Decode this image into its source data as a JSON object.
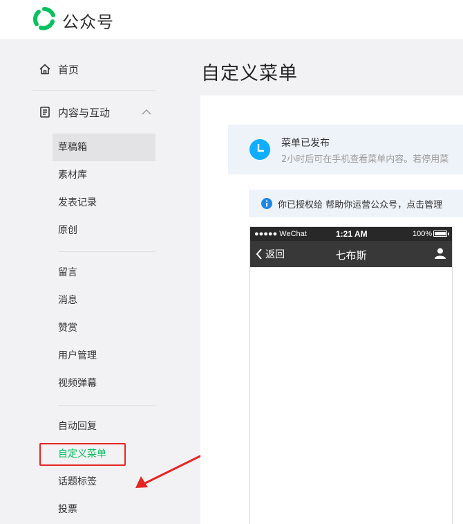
{
  "header": {
    "brand": "公众号"
  },
  "sidebar": {
    "home_label": "首页",
    "group_label": "内容与互动",
    "group1": [
      "草稿箱",
      "素材库",
      "发表记录",
      "原创"
    ],
    "group2": [
      "留言",
      "消息",
      "赞赏",
      "用户管理",
      "视频弹幕"
    ],
    "group3": [
      "自动回复",
      "自定义菜单",
      "话题标签",
      "投票"
    ]
  },
  "main": {
    "title": "自定义菜单",
    "notice": {
      "title": "菜单已发布",
      "desc": "2小时后可在手机查看菜单内容。若停用菜"
    },
    "info": "你已授权给  帮助你运营公众号，点击管理"
  },
  "phone": {
    "carrier": "●●●●● WeChat",
    "time": "1:21 AM",
    "battery": "100%",
    "back_label": "返回",
    "account_name": "七布斯"
  },
  "colors": {
    "accent": "#07c160",
    "highlight": "#e62424",
    "info": "#1e88e5"
  }
}
